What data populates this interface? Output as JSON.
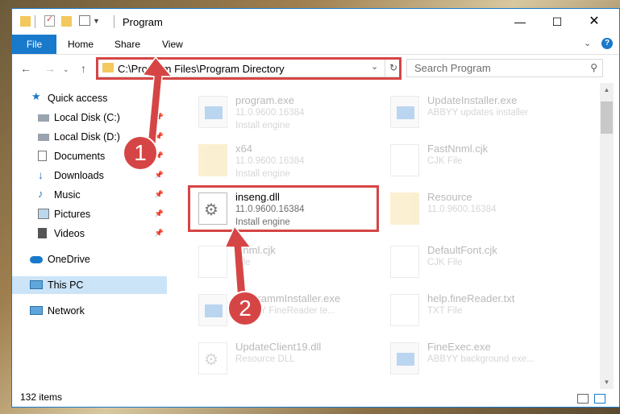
{
  "window": {
    "title": "Program"
  },
  "ribbon": {
    "tabs": [
      "File",
      "Home",
      "Share",
      "View"
    ]
  },
  "address": {
    "path": "C:\\Program Files\\Program Directory"
  },
  "search": {
    "placeholder": "Search Program"
  },
  "sidebar": {
    "items": [
      {
        "label": "Quick access",
        "icon": "star-icon",
        "pinned": false
      },
      {
        "label": "Local Disk (C:)",
        "icon": "drive-icon",
        "pinned": true
      },
      {
        "label": "Local Disk (D:)",
        "icon": "drive-icon",
        "pinned": true
      },
      {
        "label": "Documents",
        "icon": "documents-icon",
        "pinned": true
      },
      {
        "label": "Downloads",
        "icon": "download-icon",
        "pinned": true
      },
      {
        "label": "Music",
        "icon": "music-icon",
        "pinned": true
      },
      {
        "label": "Pictures",
        "icon": "pictures-icon",
        "pinned": true
      },
      {
        "label": "Videos",
        "icon": "videos-icon",
        "pinned": true
      },
      {
        "label": "OneDrive",
        "icon": "cloud-icon",
        "pinned": false
      },
      {
        "label": "This PC",
        "icon": "computer-icon",
        "pinned": false,
        "selected": true
      },
      {
        "label": "Network",
        "icon": "network-icon",
        "pinned": false
      }
    ]
  },
  "files": [
    {
      "name": "program.exe",
      "version": "11.0.9600.16384",
      "type": "Install engine"
    },
    {
      "name": "UpdateInstaller.exe",
      "version": "ABBYY updates installer",
      "type": ""
    },
    {
      "name": "x64",
      "version": "11.0.9600.16384",
      "type": "Install engine"
    },
    {
      "name": "FastNnml.cjk",
      "version": "CJK File",
      "type": ""
    },
    {
      "name": "inseng.dll",
      "version": "11.0.9600.16384",
      "type": "Install engine"
    },
    {
      "name": "Resource",
      "version": "11.0.9600.16384",
      "type": ""
    },
    {
      "name": "Nnml.cjk",
      "version": "File",
      "type": ""
    },
    {
      "name": "DefaultFont.cjk",
      "version": "CJK File",
      "type": ""
    },
    {
      "name": "ProgrammInstaller.exe",
      "version": "ABBYY FineReader te...",
      "type": ""
    },
    {
      "name": "help.fineReader.txt",
      "version": "TXT File",
      "type": ""
    },
    {
      "name": "UpdateClient19.dll",
      "version": "Resource DLL",
      "type": ""
    },
    {
      "name": "FineExec.exe",
      "version": "ABBYY background exe...",
      "type": ""
    }
  ],
  "status": {
    "count": "132 items"
  },
  "annotations": {
    "step1": "1",
    "step2": "2"
  },
  "colors": {
    "accent": "#1979ca",
    "highlight": "#d64545",
    "selected": "#cce4f7"
  }
}
